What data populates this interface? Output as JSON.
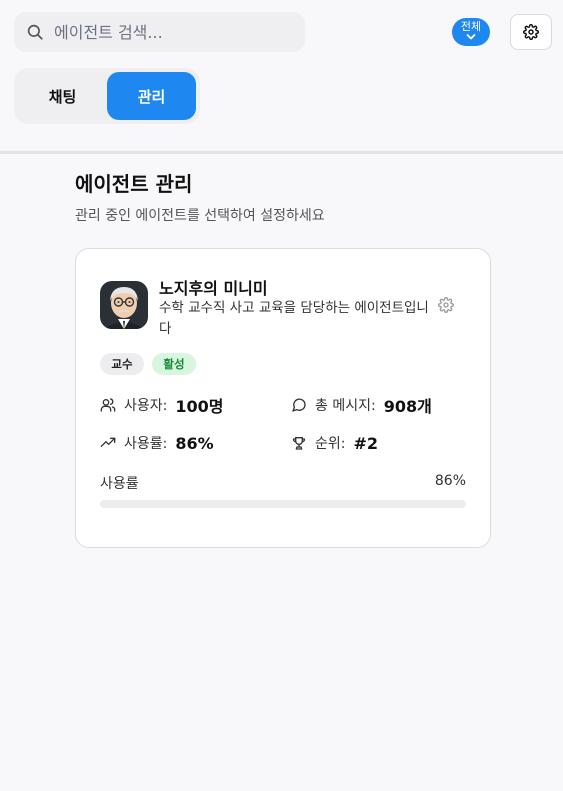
{
  "search": {
    "placeholder": "에이전트 검색..."
  },
  "filter": {
    "label": "전체"
  },
  "tabs": [
    {
      "label": "채팅",
      "active": false
    },
    {
      "label": "관리",
      "active": true
    }
  ],
  "page": {
    "title": "에이전트 관리",
    "subtitle": "관리 중인 에이전트를 선택하여 설정하세요"
  },
  "agent": {
    "name": "노지후의 미니미",
    "description": "수학 교수직 사고 교육을 담당하는 에이전트입니다",
    "badges": {
      "role": "교수",
      "status": "활성"
    },
    "stats": {
      "users_label": "사용자:",
      "users_value": "100명",
      "messages_label": "총 메시지:",
      "messages_value": "908개",
      "usage_label": "사용률:",
      "usage_value": "86%",
      "rank_label": "순위:",
      "rank_value": "#2"
    },
    "progress": {
      "label": "사용률",
      "value_text": "86%",
      "value": 86
    }
  },
  "colors": {
    "accent": "#1e88f0",
    "status_bg": "#d8f5df",
    "status_text": "#178a3a",
    "tag_bg": "#ededf0"
  },
  "icons": {
    "search": "search-icon",
    "settings": "gear-icon",
    "filter_chevron": "chevron-down-icon",
    "users": "users-icon",
    "messages": "message-circle-icon",
    "usage": "trending-up-icon",
    "rank": "trophy-icon"
  }
}
